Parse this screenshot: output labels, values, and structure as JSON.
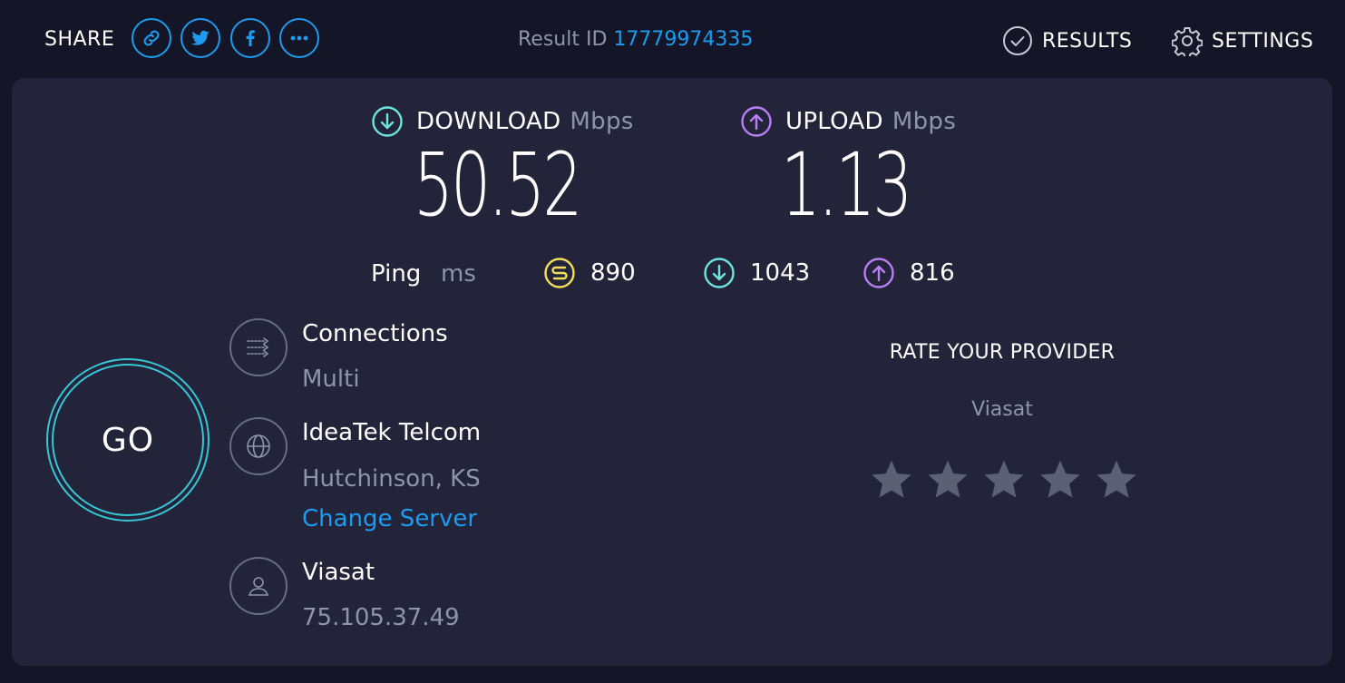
{
  "header": {
    "share_label": "SHARE",
    "result_id_label": "Result ID",
    "result_id_value": "17779974335",
    "results_label": "RESULTS",
    "settings_label": "SETTINGS"
  },
  "download": {
    "label": "DOWNLOAD",
    "unit": "Mbps",
    "value": "50.52"
  },
  "upload": {
    "label": "UPLOAD",
    "unit": "Mbps",
    "value": "1.13"
  },
  "ping": {
    "label": "Ping",
    "unit": "ms",
    "idle": "890",
    "download": "1043",
    "upload": "816"
  },
  "go_label": "GO",
  "connections": {
    "title": "Connections",
    "value": "Multi"
  },
  "server": {
    "name": "IdeaTek Telcom",
    "location": "Hutchinson, KS",
    "change_label": "Change Server"
  },
  "isp": {
    "name": "Viasat",
    "ip": "75.105.37.49"
  },
  "rate": {
    "title": "RATE YOUR PROVIDER",
    "provider": "Viasat",
    "stars_total": 5,
    "stars_selected": 0
  },
  "colors": {
    "background": "#141526",
    "card": "#23243a",
    "accent_blue": "#1d9bf0",
    "download_cyan": "#6ee4e0",
    "upload_purple": "#b97ff5",
    "ping_yellow": "#f2e05a",
    "muted_text": "#9193a8",
    "star_gray": "#5d5f73"
  },
  "icons": [
    "link-icon",
    "twitter-icon",
    "facebook-icon",
    "more-icon",
    "check-circle-icon",
    "gear-icon",
    "download-arrow-icon",
    "upload-arrow-icon",
    "ping-idle-icon",
    "connections-icon",
    "globe-icon",
    "user-icon",
    "star-icon"
  ]
}
